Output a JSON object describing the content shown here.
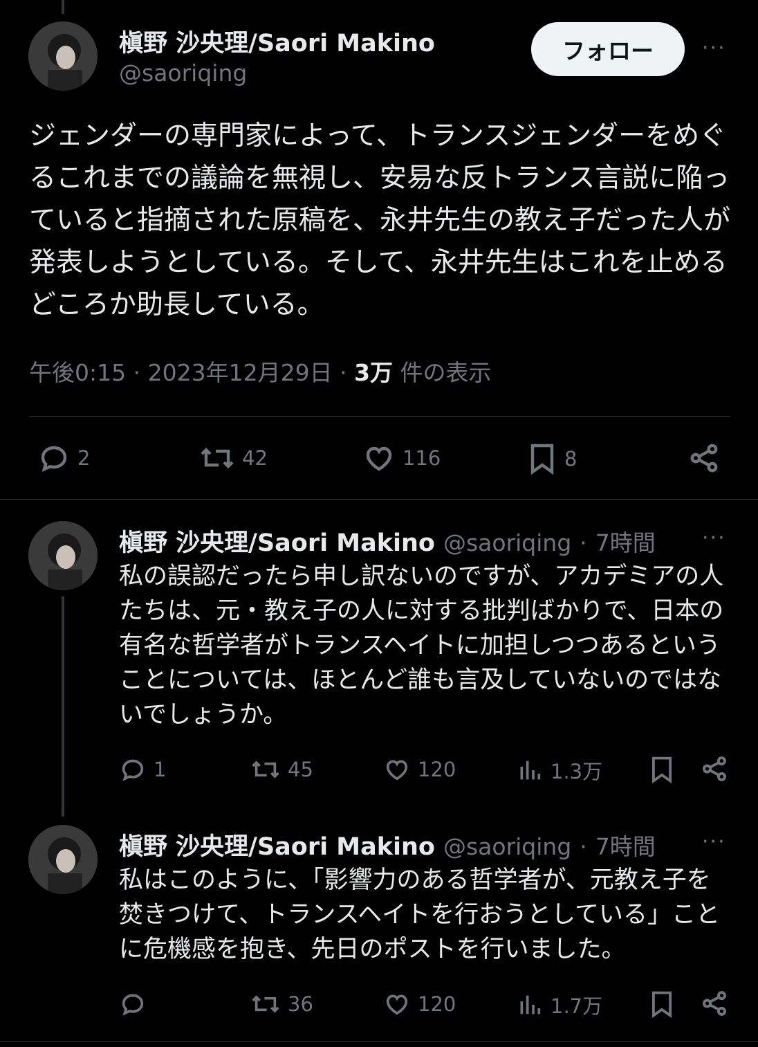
{
  "main_tweet": {
    "author_name": "槇野 沙央理/Saori Makino",
    "handle": "@saoriqing",
    "follow_label": "フォロー",
    "more_label": "···",
    "text": "ジェンダーの専門家によって、トランスジェンダーをめぐるこれまでの議論を無視し、安易な反トランス言説に陥っていると指摘された原稿を、永井先生の教え子だった人が発表しようとしている。そして、永井先生はこれを止めるどころか助長している。",
    "time": "午後0:15",
    "date": "2023年12月29日",
    "views_count": "3万",
    "views_label": "件の表示",
    "sep": "·",
    "actions": {
      "replies": "2",
      "reposts": "42",
      "likes": "116",
      "bookmarks": "8"
    }
  },
  "replies": [
    {
      "author_name": "槇野 沙央理/Saori Makino",
      "handle": "@saoriqing",
      "sep": "·",
      "time": "7時間",
      "more_label": "···",
      "text": "私の誤認だったら申し訳ないのですが、アカデミアの人たちは、元・教え子の人に対する批判ばかりで、日本の有名な哲学者がトランスヘイトに加担しつつあるということについては、ほとんど誰も言及していないのではないでしょうか。",
      "actions": {
        "replies": "1",
        "reposts": "45",
        "likes": "120",
        "views": "1.3万"
      }
    },
    {
      "author_name": "槇野 沙央理/Saori Makino",
      "handle": "@saoriqing",
      "sep": "·",
      "time": "7時間",
      "more_label": "···",
      "text": "私はこのように、「影響力のある哲学者が、元教え子を焚きつけて、トランスヘイトを行おうとしている」ことに危機感を抱き、先日のポストを行いました。",
      "actions": {
        "replies": "",
        "reposts": "36",
        "likes": "120",
        "views": "1.7万"
      }
    }
  ],
  "colors": {
    "background": "#000000",
    "text": "#e7e9ea",
    "secondary": "#71767b",
    "divider": "#2f3336",
    "follow_bg": "#eff3f4"
  },
  "icons": [
    "reply-icon",
    "repost-icon",
    "like-icon",
    "bookmark-icon",
    "share-icon",
    "views-icon",
    "more-icon"
  ]
}
